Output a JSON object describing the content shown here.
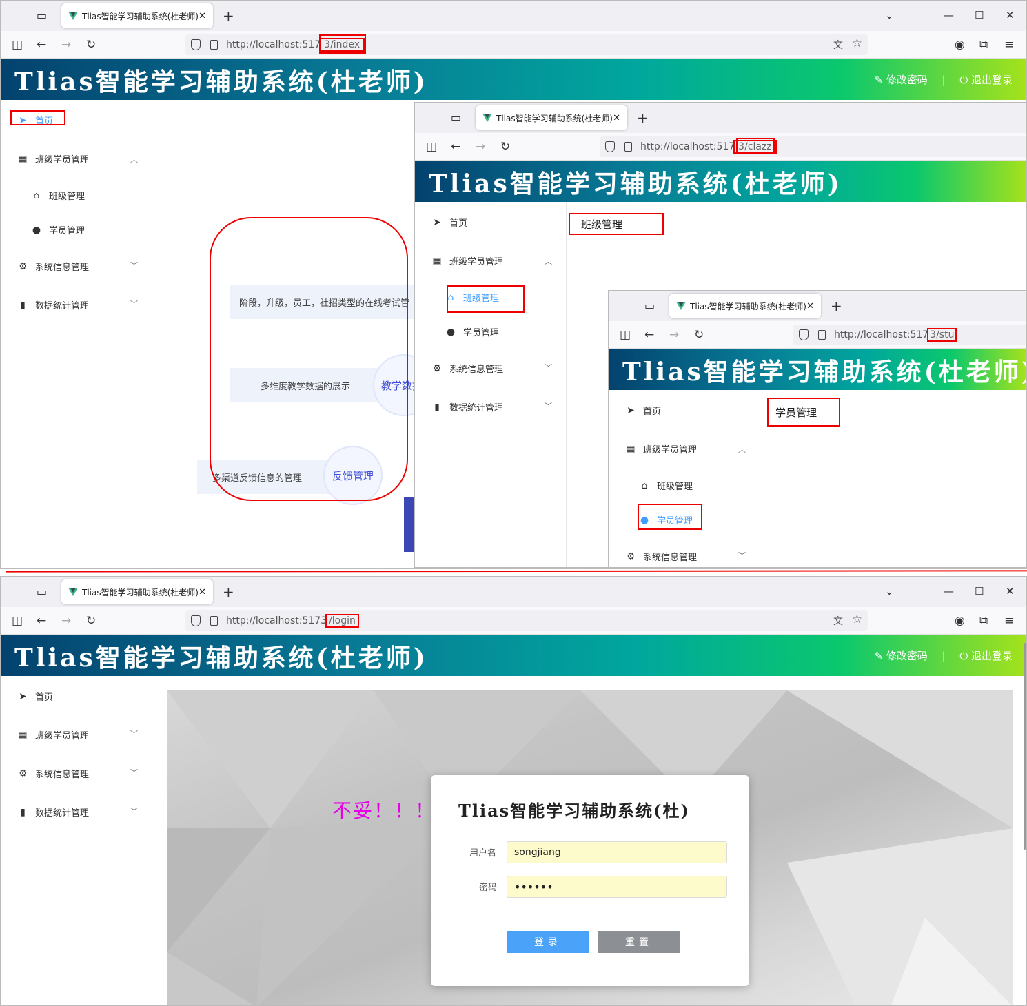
{
  "tab_title": "Tlias智能学习辅助系统(杜老师)",
  "url_base": "http://localhost:5173",
  "url_base_clip": "http://localhost:517",
  "urls": {
    "index": "/index",
    "clazz": "/clazz",
    "stu": "/stu",
    "login": "/login"
  },
  "url_paths": {
    "index": "3/index",
    "clazz": "3/clazz",
    "stu": "3/stu",
    "login": "/login"
  },
  "app_title": "Tlias智能学习辅助系统(杜老师)",
  "header": {
    "change_pwd": "修改密码",
    "logout": "退出登录",
    "sep": "|"
  },
  "menu": {
    "home": "首页",
    "class_student": "班级学员管理",
    "class": "班级管理",
    "student": "学员管理",
    "system": "系统信息管理",
    "stats": "数据统计管理"
  },
  "home_content": {
    "pill1": "阶段，升级，员工，社招类型的在线考试管",
    "pill2": "多维度教学数据的展示",
    "circle2": "教学数据",
    "pill3": "多渠道反馈信息的管理",
    "circle3": "反馈管理"
  },
  "clazz_content": "班级管理",
  "stu_content": "学员管理",
  "login": {
    "overlay_text": "不妥！！！",
    "dialog_title": "Tlias智能学习辅助系统(杜)",
    "username_label": "用户名",
    "username_value": "songjiang",
    "password_label": "密码",
    "password_value": "••••••",
    "login_button": "登录",
    "reset_button": "重置"
  },
  "icons": [
    "tab-overview-icon",
    "vue-logo-icon",
    "close-icon",
    "plus-icon",
    "sidebar-icon",
    "back-icon",
    "forward-icon",
    "reload-icon",
    "shield-icon",
    "page-icon",
    "translate-icon",
    "star-icon",
    "account-icon",
    "extension-icon",
    "menu-icon",
    "paper-plane-icon",
    "grid-icon",
    "home-icon",
    "user-icon",
    "gear-icon",
    "bar-chart-icon",
    "chevron-up-icon",
    "chevron-down-icon",
    "edit-icon",
    "power-icon"
  ],
  "colors": {
    "accent_red": "#e00000",
    "menu_active": "#409eff",
    "overlay_magenta": "#e600e6",
    "login_button": "#4aa3f8",
    "reset_button": "#8c8f93"
  }
}
